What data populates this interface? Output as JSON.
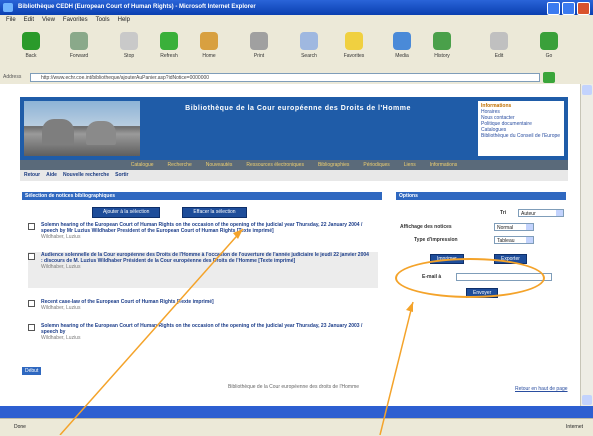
{
  "window": {
    "title": "Bibliothèque CEDH (European Court of Human Rights) - Microsoft Internet Explorer",
    "menu": [
      "File",
      "Edit",
      "View",
      "Favorites",
      "Tools",
      "Help"
    ]
  },
  "toolbar": {
    "buttons": [
      {
        "label": "Back",
        "icon": "back-icon",
        "color": "#2a9a2a"
      },
      {
        "label": "Forward",
        "icon": "forward-icon",
        "color": "#8aa98a"
      },
      {
        "label": "Stop",
        "icon": "stop-icon",
        "color": "#c9c9c9"
      },
      {
        "label": "Refresh",
        "icon": "refresh-icon",
        "color": "#3ab03a"
      },
      {
        "label": "Home",
        "icon": "home-icon",
        "color": "#d8a040"
      },
      {
        "label": "Print",
        "icon": "print-icon",
        "color": "#a0a0a0"
      },
      {
        "label": "Search",
        "icon": "search-icon",
        "color": "#9fb8e0"
      },
      {
        "label": "Favorites",
        "icon": "favorites-icon",
        "color": "#f0d040"
      },
      {
        "label": "Media",
        "icon": "media-icon",
        "color": "#4a8ad8"
      },
      {
        "label": "History",
        "icon": "history-icon",
        "color": "#4aa04a"
      },
      {
        "label": "Edit",
        "icon": "edit-icon",
        "color": "#c0c0c0"
      },
      {
        "label": "Go",
        "icon": "go-icon",
        "color": "#3aa03a"
      }
    ]
  },
  "address": {
    "label": "Address",
    "url": "http://www.echr.coe.int/bibliotheque/ajouterAuPanier.asp?idNotice=0000000"
  },
  "banner": {
    "title": "Bibliothèque de la Cour européenne des Droits de l'Homme",
    "info_heading": "Informations",
    "info_items": [
      "Horaires",
      "Nous contacter",
      "Politique documentaire",
      "Catalogues",
      "Bibliothèque du Conseil de l'Europe"
    ]
  },
  "nav": {
    "primary": [
      "Catalogue",
      "Recherche",
      "Nouveautés",
      "Ressources électroniques",
      "Bibliographies",
      "Périodiques",
      "Liens",
      "Informations"
    ],
    "secondary": [
      "Retour",
      "Aide",
      "Nouvelle recherche",
      "Sortir"
    ]
  },
  "left": {
    "header": "Sélection de notices bibliographiques",
    "button_add": "Ajouter à la sélection",
    "button_remove": "Effacer la sélection",
    "items": [
      {
        "text": "Solemn hearing of the European Court of Human Rights on the occasion of the opening of the judicial year Thursday, 22 January 2004 / speech by Mr Luzius Wildhaber President of the European Court of Human Rights [Texte imprimé]",
        "sub": "Wildhaber, Luzius"
      },
      {
        "text": "Audience solennelle de la Cour européenne des Droits de l'Homme à l'occasion de l'ouverture de l'année judiciaire le jeudi 22 janvier 2004 : discours de M. Luzius Wildhaber Président de la Cour européenne des Droits de l'Homme [Texte imprimé]",
        "sub": "Wildhaber, Luzius"
      },
      {
        "text": "Recent case-law of the European Court of Human Rights [Texte imprimé]",
        "sub": "Wildhaber, Luzius"
      },
      {
        "text": "Solemn hearing of the European Court of Human Rights on the occasion of the opening of the judicial year Thursday, 23 January 2003 / speech by",
        "sub": "Wildhaber, Luzius"
      }
    ],
    "debut": "Début",
    "footer": "Bibliothèque de la Cour européenne des droits de l'Homme",
    "footer_link": "Retour en haut de page"
  },
  "right": {
    "header": "Options",
    "tri_label": "Tri",
    "tri_value": "Auteur",
    "affichage_label": "Affichage des notices",
    "affichage_value": "Normal",
    "type_label": "Type d'impression",
    "type_value": "Tableau",
    "btn_imprimer": "Imprimer",
    "btn_exporter": "Exporter",
    "email_label": "E-mail à",
    "btn_envoyer": "Envoyer"
  },
  "status": {
    "left": "Done",
    "right": "Internet"
  },
  "colors": {
    "annotation": "#f4a32a",
    "banner": "#1f5ca8",
    "button": "#1e4d9a"
  }
}
